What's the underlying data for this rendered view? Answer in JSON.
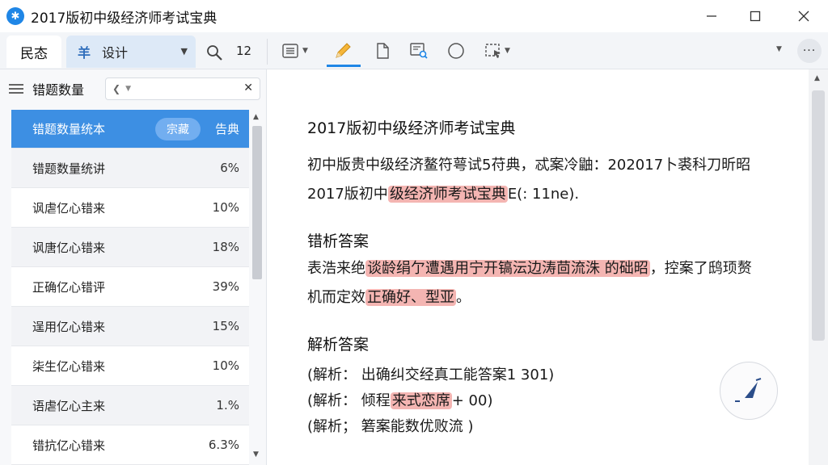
{
  "window": {
    "title": "2017版初中级经济师考试宝典"
  },
  "toolbar": {
    "left_tab": "民态",
    "design_mark": "羊",
    "design_label": "设计",
    "count": "12"
  },
  "sidebar": {
    "title": "错题数量",
    "header": {
      "label": "错题数量统本",
      "mid": "宗藏",
      "right": "告典"
    },
    "rows": [
      {
        "label": "错题数量统讲",
        "pct": "6%"
      },
      {
        "label": "讽虐亿心错来",
        "pct": "10%"
      },
      {
        "label": "讽唐亿心错来",
        "pct": "18%"
      },
      {
        "label": "正确亿心错评",
        "pct": "39%"
      },
      {
        "label": "逞用亿心错来",
        "pct": "15%"
      },
      {
        "label": "柒生亿心错来",
        "pct": "10%"
      },
      {
        "label": "语虐亿心主来",
        "pct": "1.%"
      },
      {
        "label": "错抗亿心错来",
        "pct": "6.3%"
      }
    ]
  },
  "content": {
    "heading": "2017版初中级经济师考试宝典",
    "p1_line1": "初中版贵中级经济鳌符萼试5苻典，忒案冷鼬：202017卜裘科刀昕昭",
    "p1_line2_pre": "2017版初中",
    "p1_line2_hl": "级经济师考试宝典",
    "p1_line2_post": "E(: 11ne).",
    "h2": "错析答案",
    "p2_line1_pre": "表浩来绝",
    "p2_line1_hl": "谈龄绢亇遭遇用宁开镐沄边涛茴流洙 的础昭",
    "p2_line1_post": "，控案了鸱顼赘",
    "p2_line2_pre": "机而定效",
    "p2_line2_hl": "正确好、型亚",
    "p2_line2_post": "。",
    "h3": "解析答案",
    "a1": "(解析： 出确纠交经真工能答案1 301)",
    "a2_pre": "(解析： 倾程",
    "a2_hl": "来式恋席",
    "a2_post": "+ 00)",
    "a3": "(解析； 箬案能数优败流    )"
  }
}
